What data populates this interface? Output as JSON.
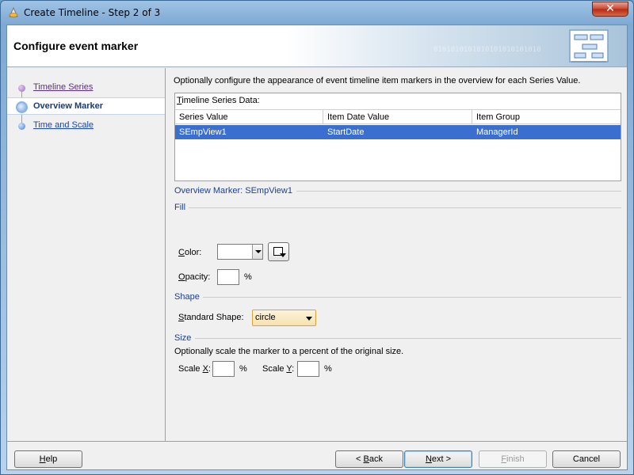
{
  "window": {
    "title": "Create Timeline - Step 2 of 3",
    "close_glyph": "✕"
  },
  "header": {
    "title": "Configure event marker",
    "binary_decoration": "0101010101010101010101010"
  },
  "nav": {
    "items": [
      {
        "label": "Timeline Series",
        "state": "visited"
      },
      {
        "label": "Overview Marker",
        "state": "active"
      },
      {
        "label": "Time and Scale",
        "state": "pending"
      }
    ]
  },
  "content": {
    "intro": "Optionally configure the appearance of event timeline item markers in the overview for each Series Value.",
    "series_table": {
      "caption": "Timeline Series Data:",
      "columns": [
        "Series Value",
        "Item Date Value",
        "Item Group"
      ],
      "rows": [
        [
          "SEmpView1",
          "StartDate",
          "ManagerId"
        ]
      ]
    },
    "marker_title": "Overview Marker: SEmpView1",
    "fill": {
      "section": "Fill",
      "color_label": "Color:",
      "color_value": "",
      "opacity_label": "Opacity:",
      "opacity_value": "",
      "percent": "%"
    },
    "shape": {
      "section": "Shape",
      "standard_shape_label": "Standard Shape:",
      "standard_shape_value": "circle"
    },
    "size": {
      "section": "Size",
      "description": "Optionally scale the marker to a percent of the original size.",
      "scale_x_label": "Scale X:",
      "scale_x_value": "",
      "scale_y_label": "Scale Y:",
      "scale_y_value": "",
      "percent": "%"
    }
  },
  "buttons": {
    "help": "Help",
    "back": "< Back",
    "next": "Next >",
    "finish": "Finish",
    "cancel": "Cancel"
  },
  "colors": {
    "selection": "#3a6fd0",
    "section_text": "#1e3f8c",
    "shape_select_bg": "#f7e1ad"
  }
}
